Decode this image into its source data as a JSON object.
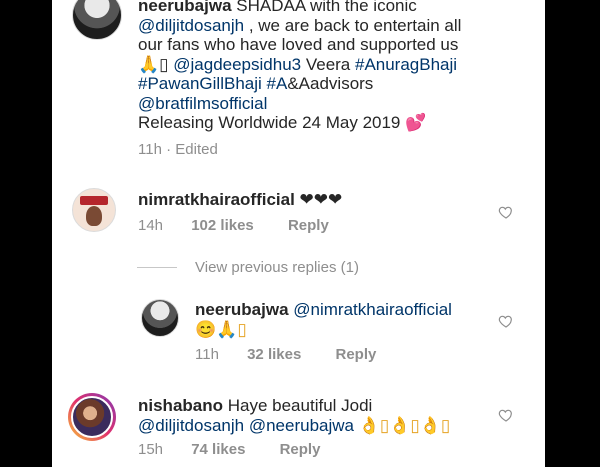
{
  "post": {
    "username": "neerubajwa",
    "line1_text": "SHADAA  with the iconic",
    "line2_mention": "@diljitdosanjh",
    "line2_text": " , we are back to entertain all",
    "line3_text": "our fans who have loved and supported us",
    "line4_emoji": "🙏",
    "line4_box": "▯ ",
    "line4_mention": "@jagdeepsidhu3",
    "line4_text": " Veera ",
    "line4_tag": "#AnuragBhaji",
    "line5_tag1": "#PawanGillBhaji",
    "line5_tag2": "#A",
    "line5_text": "&Aadvisors",
    "line6_mention": "@bratfilmsofficial",
    "line7_text": "Releasing Worldwide 24 May 2019 ",
    "line7_emoji": "💕",
    "time": "11h",
    "sep": " · ",
    "edited": "Edited"
  },
  "comments": [
    {
      "username": "nimratkhairaofficial",
      "text": " ❤❤❤",
      "time": "14h",
      "likes": "102 likes",
      "reply_label": "Reply"
    },
    {
      "username": "nishabano",
      "text_line1": " Haye beautiful Jodi",
      "mention1": "@diljitdosanjh",
      "mention2": "@neerubajwa",
      "emoji": " 👌▯👌▯👌▯",
      "time": "15h",
      "likes": "74 likes",
      "reply_label": "Reply"
    }
  ],
  "replies_toggle": "View previous replies (1)",
  "reply": {
    "username": "neerubajwa",
    "mention": "@nimratkhairaofficial",
    "emoji": "😊🙏▯",
    "time": "11h",
    "likes": "32 likes",
    "reply_label": "Reply"
  },
  "colors": {
    "link": "#003569",
    "text": "#262626",
    "meta": "#8e8e8e"
  }
}
